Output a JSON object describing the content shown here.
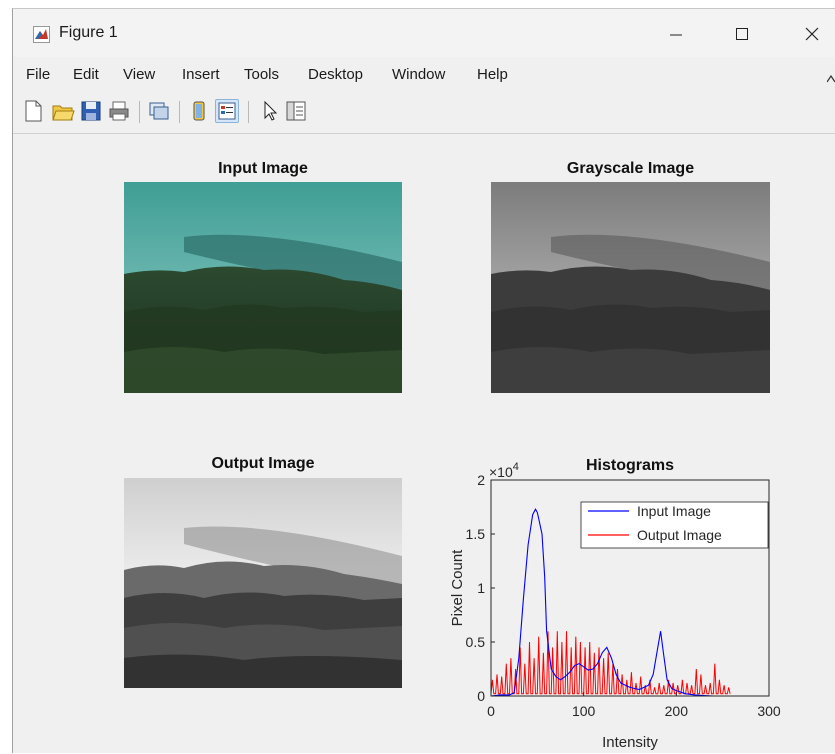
{
  "window": {
    "title": "Figure 1",
    "controls": {
      "minimize": "—",
      "maximize": "☐",
      "close": "✕"
    }
  },
  "menu": [
    "File",
    "Edit",
    "View",
    "Insert",
    "Tools",
    "Desktop",
    "Window",
    "Help"
  ],
  "toolbar": [
    "new-figure",
    "open-file",
    "save",
    "print",
    "link-plot",
    "hide-plot-tools",
    "show-plot-tools",
    "edit-plot",
    "property-inspector"
  ],
  "panels": {
    "input": {
      "title": "Input Image"
    },
    "gray": {
      "title": "Grayscale Image"
    },
    "output": {
      "title": "Output Image"
    }
  },
  "chart_data": {
    "type": "line",
    "title": "Histograms",
    "xlabel": "Intensity",
    "ylabel": "Pixel Count",
    "exponent_label": "×10",
    "exponent_power": "4",
    "xlim": [
      0,
      300
    ],
    "ylim": [
      0,
      2
    ],
    "xticks": [
      "0",
      "100",
      "200",
      "300"
    ],
    "yticks": [
      "0",
      "0.5",
      "1",
      "1.5",
      "2"
    ],
    "legend_position": "top-right",
    "series": [
      {
        "name": "Input Image",
        "color": "#0000ff",
        "x": [
          0,
          10,
          20,
          25,
          30,
          35,
          40,
          45,
          48,
          50,
          52,
          55,
          58,
          60,
          65,
          70,
          75,
          80,
          85,
          90,
          95,
          100,
          105,
          110,
          115,
          120,
          125,
          130,
          135,
          140,
          150,
          160,
          170,
          175,
          180,
          183,
          186,
          190,
          195,
          200,
          210,
          220,
          230,
          240,
          255
        ],
        "values": [
          0,
          0.01,
          0.01,
          0.03,
          0.35,
          0.9,
          1.4,
          1.68,
          1.73,
          1.7,
          1.62,
          1.5,
          1.1,
          0.6,
          0.25,
          0.18,
          0.15,
          0.18,
          0.22,
          0.28,
          0.3,
          0.27,
          0.24,
          0.25,
          0.3,
          0.4,
          0.45,
          0.35,
          0.2,
          0.12,
          0.08,
          0.06,
          0.1,
          0.2,
          0.45,
          0.6,
          0.4,
          0.15,
          0.07,
          0.05,
          0.02,
          0.01,
          0.005,
          0,
          0
        ]
      },
      {
        "name": "Output Image",
        "color": "#ff0000",
        "x": [
          0,
          5,
          10,
          15,
          20,
          25,
          30,
          35,
          40,
          45,
          50,
          55,
          60,
          65,
          70,
          75,
          80,
          85,
          90,
          95,
          100,
          105,
          110,
          115,
          120,
          125,
          130,
          135,
          140,
          145,
          150,
          155,
          160,
          165,
          170,
          175,
          180,
          185,
          190,
          195,
          200,
          205,
          210,
          215,
          220,
          225,
          230,
          235,
          240,
          245,
          250,
          255
        ],
        "values": [
          0.15,
          0.2,
          0.18,
          0.3,
          0.35,
          0.25,
          0.45,
          0.3,
          0.5,
          0.35,
          0.55,
          0.4,
          0.6,
          0.45,
          0.6,
          0.5,
          0.6,
          0.45,
          0.55,
          0.5,
          0.45,
          0.5,
          0.4,
          0.45,
          0.35,
          0.4,
          0.3,
          0.25,
          0.2,
          0.15,
          0.22,
          0.12,
          0.18,
          0.1,
          0.15,
          0.08,
          0.12,
          0.1,
          0.15,
          0.12,
          0.1,
          0.15,
          0.12,
          0.1,
          0.25,
          0.2,
          0.1,
          0.12,
          0.3,
          0.15,
          0.1,
          0.08
        ]
      }
    ]
  }
}
